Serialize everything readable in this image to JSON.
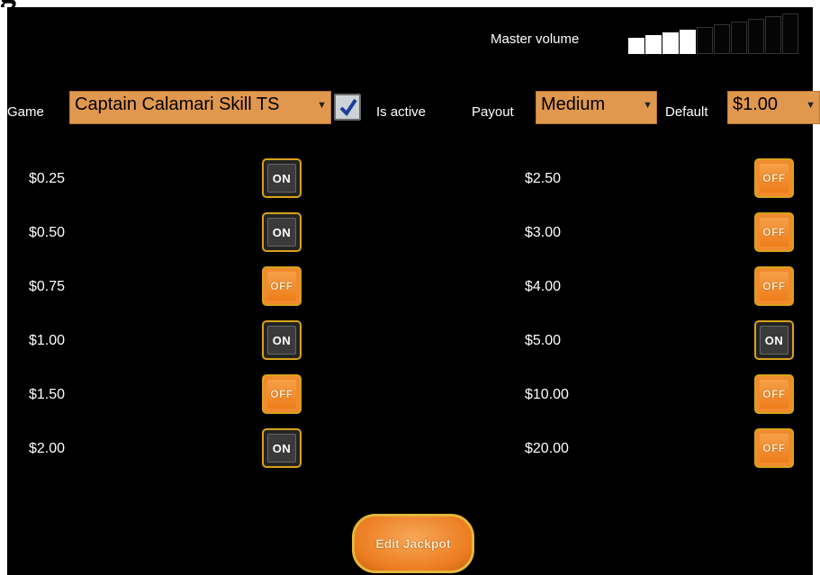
{
  "header": {
    "title_fragment": "g"
  },
  "volume": {
    "label": "Master volume",
    "level": 4,
    "max": 10,
    "active_color": "#ffffff"
  },
  "controls": {
    "game_label": "Game",
    "game_value": "Captain Calamari Skill TS",
    "is_active_label": "Is active",
    "is_active_checked": true,
    "payout_label": "Payout",
    "payout_value": "Medium",
    "default_label": "Default",
    "default_value": "$1.00",
    "dropdown_color": "#e0984f",
    "accent_color": "#d8a21b"
  },
  "denominations": {
    "left": [
      {
        "amount": "$0.25",
        "state": "ON"
      },
      {
        "amount": "$0.50",
        "state": "ON"
      },
      {
        "amount": "$0.75",
        "state": "OFF"
      },
      {
        "amount": "$1.00",
        "state": "ON"
      },
      {
        "amount": "$1.50",
        "state": "OFF"
      },
      {
        "amount": "$2.00",
        "state": "ON"
      }
    ],
    "right": [
      {
        "amount": "$2.50",
        "state": "OFF"
      },
      {
        "amount": "$3.00",
        "state": "OFF"
      },
      {
        "amount": "$4.00",
        "state": "OFF"
      },
      {
        "amount": "$5.00",
        "state": "ON"
      },
      {
        "amount": "$10.00",
        "state": "OFF"
      },
      {
        "amount": "$20.00",
        "state": "OFF"
      }
    ]
  },
  "actions": {
    "edit_jackpot_label": "Edit Jackpot"
  }
}
